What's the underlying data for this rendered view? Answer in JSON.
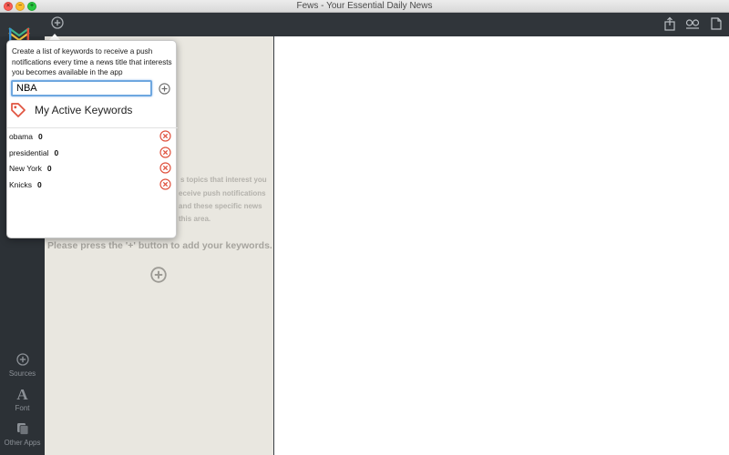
{
  "window": {
    "title": "Fews - Your Essential Daily News"
  },
  "toolbar": {
    "add_icon": "plus-circle-icon",
    "right_icons": [
      "share-icon",
      "reader-glasses-icon",
      "document-icon"
    ]
  },
  "sidebar": {
    "items": [
      {
        "label": "Sources",
        "icon": "plus-circle-icon"
      },
      {
        "label": "Font",
        "icon": "font-a-icon"
      },
      {
        "label": "Other Apps",
        "icon": "apps-stack-icon"
      }
    ]
  },
  "middle": {
    "hint_lines": [
      "s topics that interest you",
      "eceive push notifications",
      "and these specific news",
      "this area."
    ],
    "big_hint": "Please press the '+' button to add your keywords."
  },
  "popover": {
    "description": "Create a list of keywords to receive a push notifications every time a news title that interests you becomes available in the app",
    "input_value": "NBA",
    "active_title": "My Active Keywords",
    "keywords": [
      {
        "name": "obama",
        "count": "0"
      },
      {
        "name": "presidential",
        "count": "0"
      },
      {
        "name": "New York",
        "count": "0"
      },
      {
        "name": "Knicks",
        "count": "0"
      }
    ]
  },
  "colors": {
    "accent_red": "#e0533f",
    "logo_green": "#3fb58a",
    "logo_yellow": "#f2c443"
  }
}
